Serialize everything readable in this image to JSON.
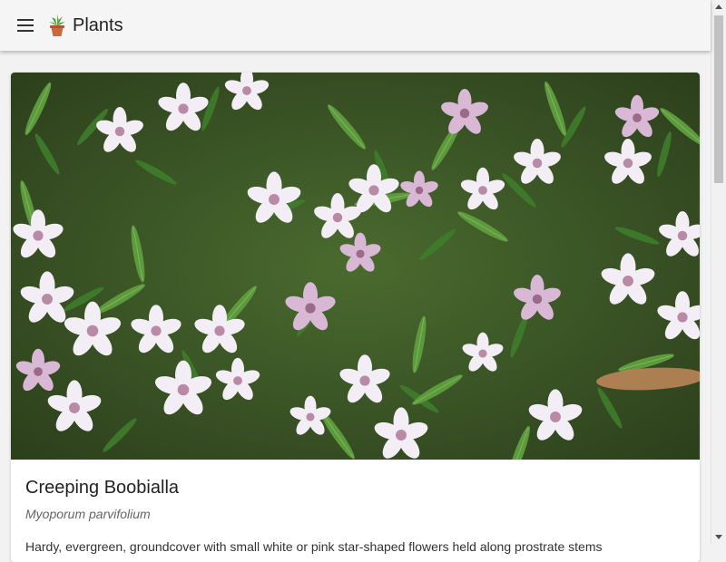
{
  "app": {
    "title": "Plants",
    "menu_icon": "hamburger-menu-icon",
    "logo_icon": "potted-plant-icon"
  },
  "plant": {
    "name": "Creeping Boobialla",
    "scientific_name": "Myoporum parvifolium",
    "description_preview": "Hardy, evergreen, groundcover with small white or pink star-shaped flowers held along prostrate stems"
  },
  "colors": {
    "app_bar": "#f5f5f5",
    "background": "#f2f2f2",
    "card": "#ffffff"
  }
}
